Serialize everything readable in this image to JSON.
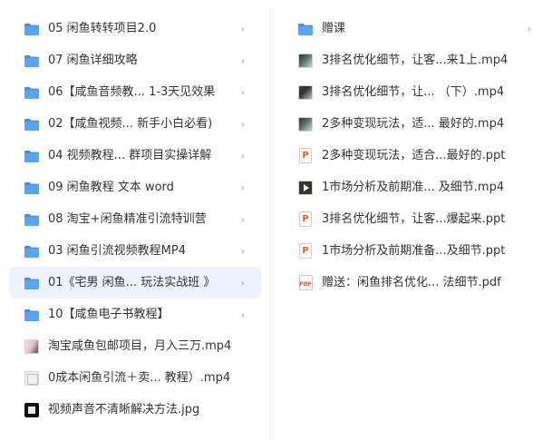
{
  "left_pane": {
    "items": [
      {
        "label": "05 闲鱼转转项目2.0",
        "kind": "folder",
        "chevron": "›",
        "selected": false
      },
      {
        "label": "07 闲鱼详细攻略",
        "kind": "folder",
        "chevron": "›",
        "selected": false
      },
      {
        "label": "06【咸鱼音频教...  1-3天见效果",
        "kind": "folder",
        "chevron": "›",
        "selected": false
      },
      {
        "label": "02【咸鱼视频... 新手小白必看)",
        "kind": "folder",
        "chevron": "›",
        "selected": false
      },
      {
        "label": "04 视频教程...   群项目实操详解",
        "kind": "folder",
        "chevron": "›",
        "selected": false
      },
      {
        "label": "09 闲鱼教程 文本 word",
        "kind": "folder",
        "chevron": "›",
        "selected": false
      },
      {
        "label": "08 淘宝+闲鱼精准引流特训营",
        "kind": "folder",
        "chevron": "›",
        "selected": false
      },
      {
        "label": "03 闲鱼引流视频教程MP4",
        "kind": "folder",
        "chevron": "›",
        "selected": false
      },
      {
        "label": "01《宅男 闲鱼...  玩法实战班 》",
        "kind": "folder",
        "chevron": "›",
        "selected": true
      },
      {
        "label": "10【咸鱼电子书教程】",
        "kind": "folder",
        "chevron": "›",
        "selected": false
      },
      {
        "label": "淘宝咸鱼包邮项目，月入三万.mp4",
        "kind": "mp4a",
        "chevron": "",
        "selected": false
      },
      {
        "label": "0成本闲鱼引流＋卖...  教程）.mp4",
        "kind": "mp4b",
        "chevron": "",
        "selected": false
      },
      {
        "label": "视频声音不清晰解决方法.jpg",
        "kind": "jpg",
        "chevron": "",
        "selected": false
      }
    ]
  },
  "right_pane": {
    "items": [
      {
        "label": "赠课",
        "kind": "folder",
        "chevron": "›"
      },
      {
        "label": "3排名优化细节，让客...来1上.mp4",
        "kind": "video",
        "chevron": ""
      },
      {
        "label": "3排名优化细节，让...   （下）.mp4",
        "kind": "video2",
        "chevron": ""
      },
      {
        "label": "2多种变现玩法，适...   最好的.mp4",
        "kind": "video",
        "chevron": ""
      },
      {
        "label": "2多种变现玩法，适合...最好的.ppt",
        "kind": "ppt",
        "chevron": ""
      },
      {
        "label": "1市场分析及前期准...   及细节.mp4",
        "kind": "dark",
        "chevron": ""
      },
      {
        "label": "3排名优化细节，让客...爆起来.ppt",
        "kind": "ppt",
        "chevron": ""
      },
      {
        "label": "1市场分析及前期准备...及细节.ppt",
        "kind": "ppt",
        "chevron": ""
      },
      {
        "label": "赠送：闲鱼排名优化...   法细节.pdf",
        "kind": "pdf",
        "chevron": ""
      }
    ]
  },
  "icons": {
    "folder": "folder-icon",
    "video": "video-thumbnail-icon",
    "ppt": "ppt-file-icon",
    "pdf": "pdf-file-icon",
    "jpg": "image-thumbnail-icon",
    "ppt_glyph": "P",
    "pdf_glyph": "PDF"
  },
  "colors": {
    "folder": "#5ba4f0",
    "folder_tab": "#3f8ee6",
    "selected_bg": "#eef2fe",
    "ppt": "#ec5a2b",
    "pdf": "#e04848"
  }
}
